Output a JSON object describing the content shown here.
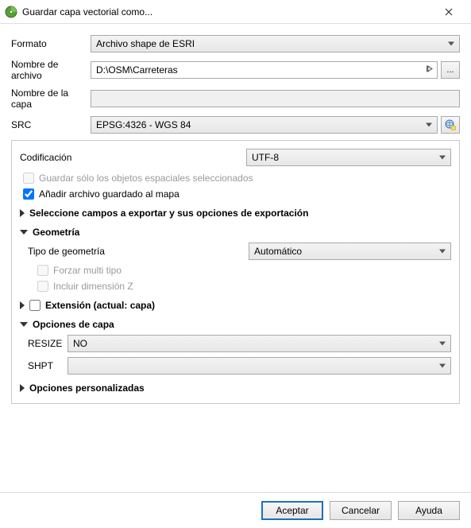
{
  "window": {
    "title": "Guardar capa vectorial como..."
  },
  "form": {
    "formato_label": "Formato",
    "formato_value": "Archivo shape de ESRI",
    "filename_label": "Nombre de archivo",
    "filename_value": "D:\\OSM\\Carreteras",
    "browse_label": "...",
    "layername_label": "Nombre de la capa",
    "layername_value": "",
    "src_label": "SRC",
    "src_value": "EPSG:4326 - WGS 84"
  },
  "group": {
    "encoding_label": "Codificación",
    "encoding_value": "UTF-8",
    "save_selected_label": "Guardar sólo los objetos espaciales seleccionados",
    "add_to_map_label": "Añadir archivo guardado al mapa",
    "sections": {
      "fields_header": "Seleccione campos a exportar y sus opciones de exportación",
      "geometry_header": "Geometría",
      "geometry_type_label": "Tipo de geometría",
      "geometry_type_value": "Automático",
      "force_multi_label": "Forzar multi tipo",
      "include_z_label": "Incluir dimensión Z",
      "extent_header": "Extensión (actual: capa)",
      "layer_options_header": "Opciones de capa",
      "resize_label": "RESIZE",
      "resize_value": "NO",
      "shpt_label": "SHPT",
      "shpt_value": "",
      "custom_options_header": "Opciones personalizadas"
    }
  },
  "buttons": {
    "ok": "Aceptar",
    "cancel": "Cancelar",
    "help": "Ayuda"
  }
}
